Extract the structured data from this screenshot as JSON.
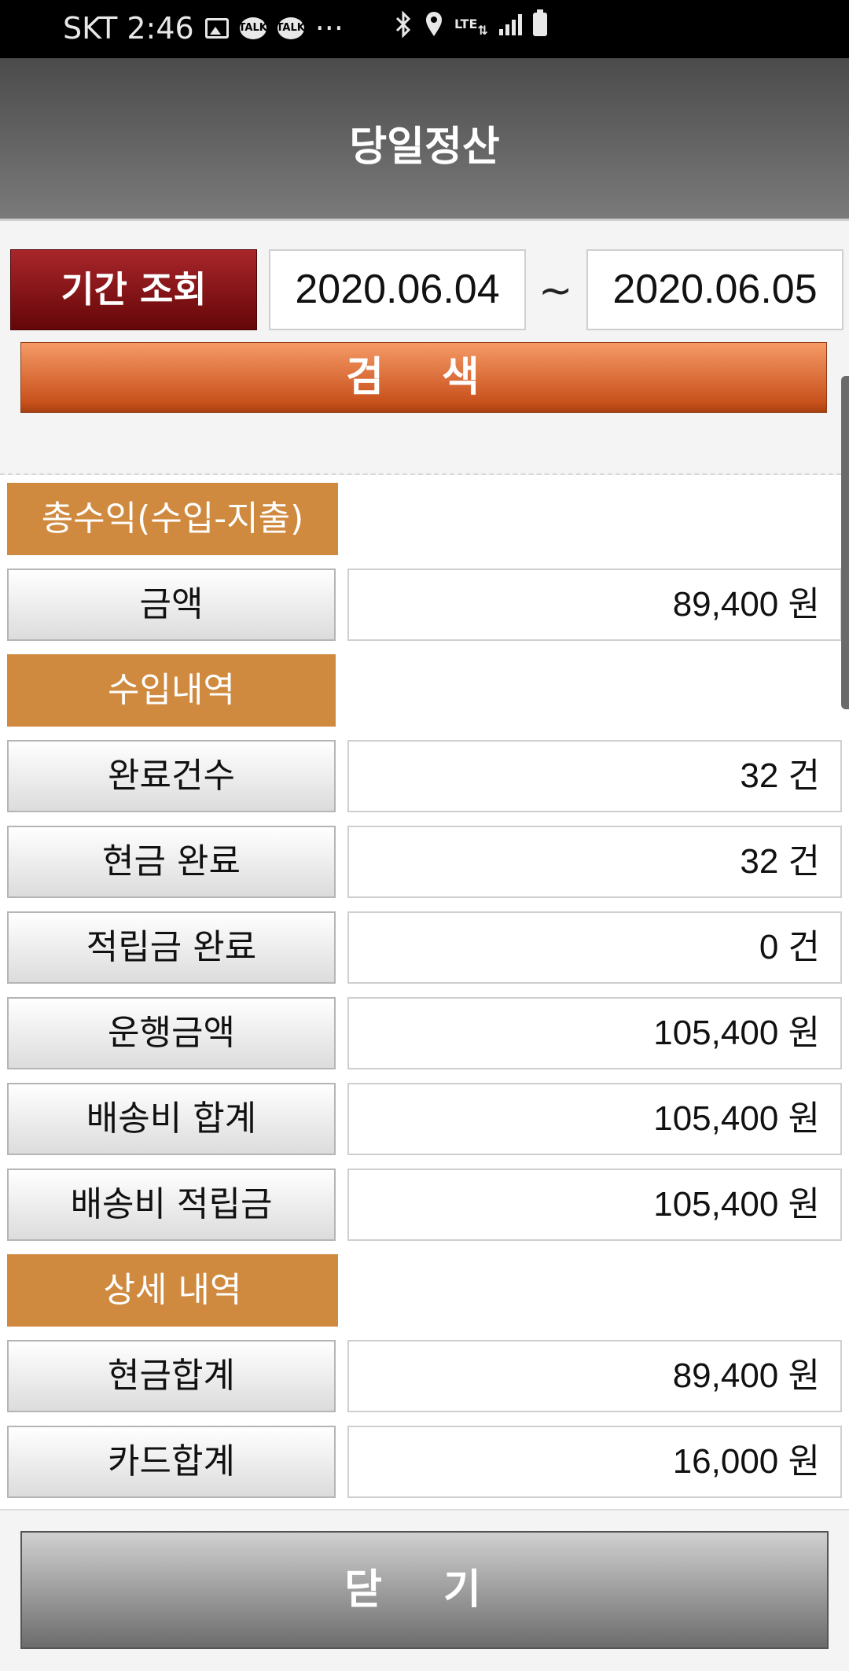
{
  "status_bar": {
    "carrier_time": "SKT 2:46",
    "talk_badge": "TALK",
    "more": "···",
    "lte": "LTE"
  },
  "header": {
    "title": "당일정산"
  },
  "period": {
    "button_label": "기간 조회",
    "start_date": "2020.06.04",
    "separator": "~",
    "end_date": "2020.06.05"
  },
  "search_label": "검 색",
  "sections": {
    "total_profit": "총수익(수입-지출)",
    "income": "수입내역",
    "detail": "상세 내역"
  },
  "rows": {
    "amount": {
      "label": "금액",
      "value": "89,400 원"
    },
    "completed_count": {
      "label": "완료건수",
      "value": "32 건"
    },
    "cash_completed": {
      "label": "현금 완료",
      "value": "32 건"
    },
    "points_completed": {
      "label": "적립금 완료",
      "value": "0 건"
    },
    "fare_amount": {
      "label": "운행금액",
      "value": "105,400 원"
    },
    "delivery_total": {
      "label": "배송비 합계",
      "value": "105,400 원"
    },
    "delivery_points": {
      "label": "배송비 적립금",
      "value": "105,400 원"
    },
    "cash_total": {
      "label": "현금합계",
      "value": "89,400 원"
    },
    "card_total": {
      "label": "카드합계",
      "value": "16,000 원"
    }
  },
  "close_label": "닫 기",
  "colors": {
    "header_gradient": [
      "#4b4b4b",
      "#7a7a7a"
    ],
    "period_button": "#8e1419",
    "search_button": "#e0703a",
    "section_header": "#d08a3f",
    "close_button": "#9a9a9a"
  }
}
